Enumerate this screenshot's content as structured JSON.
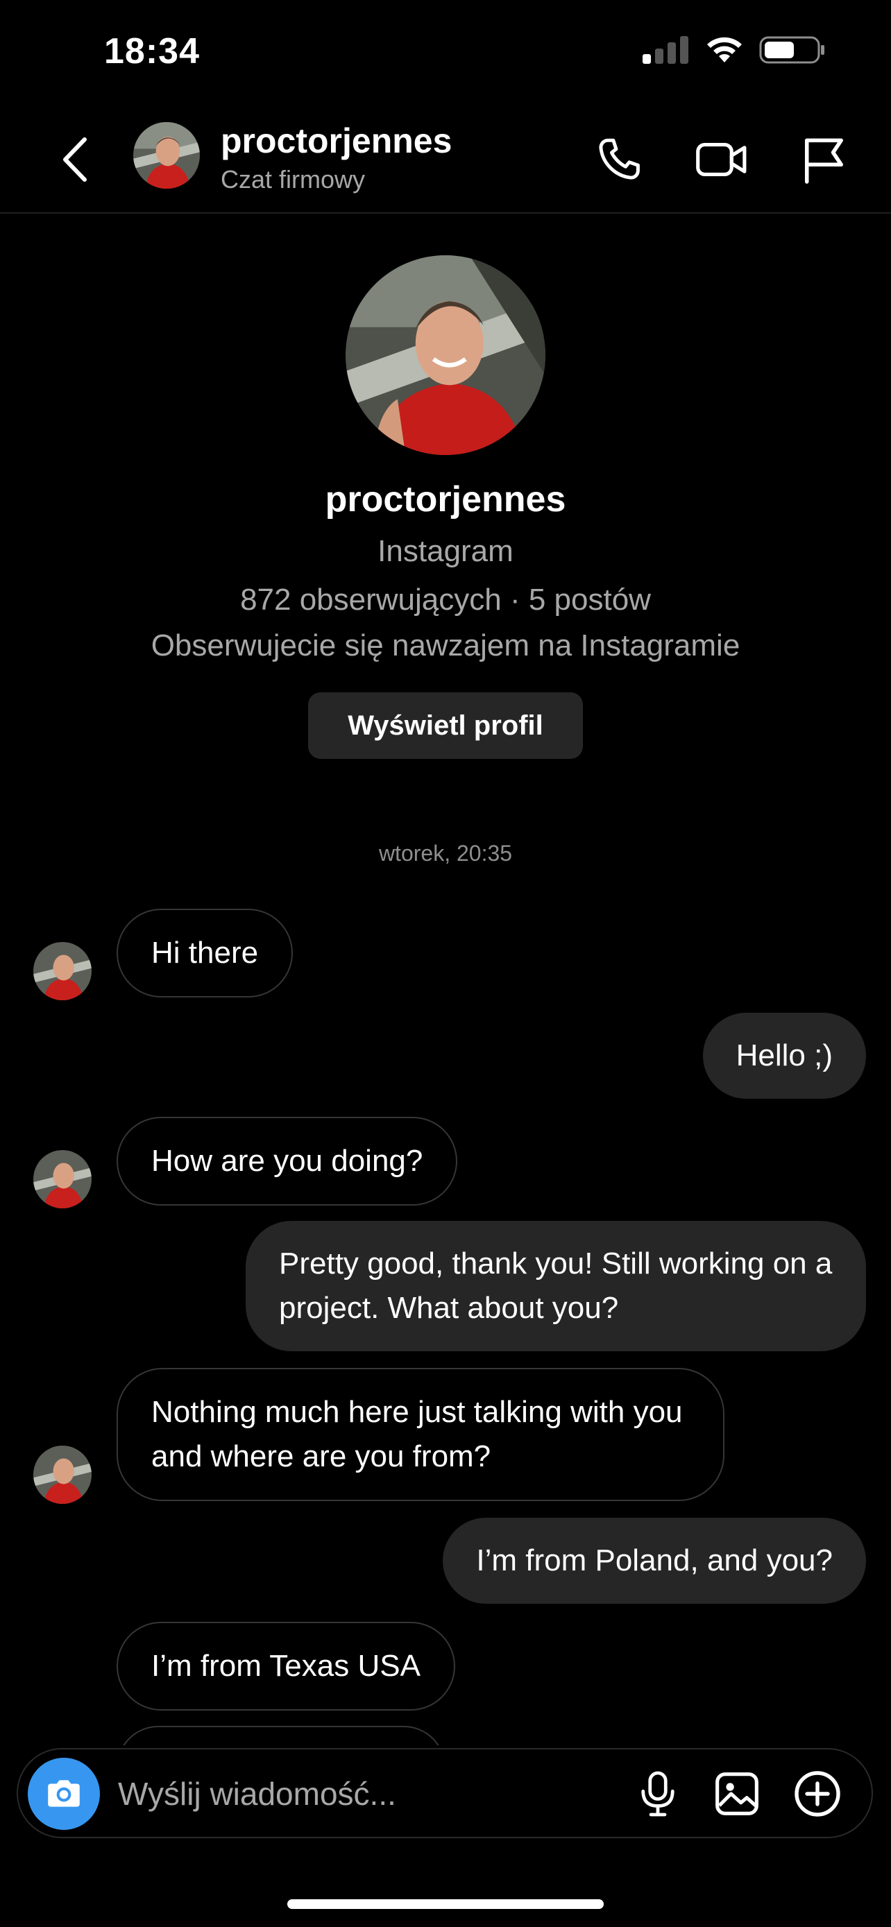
{
  "status_bar": {
    "time": "18:34"
  },
  "header": {
    "username": "proctorjennes",
    "subtitle": "Czat firmowy",
    "icons": [
      "back-icon",
      "phone-icon",
      "video-icon",
      "flag-icon"
    ]
  },
  "profile": {
    "username": "proctorjennes",
    "platform": "Instagram",
    "stats": "872 obserwujących · 5 postów",
    "mutual": "Obserwujecie się nawzajem na Instagramie",
    "view_profile_label": "Wyświetl profil"
  },
  "conversation": {
    "date_separator": "wtorek, 20:35",
    "messages": [
      {
        "from": "them",
        "text": "Hi there"
      },
      {
        "from": "me",
        "text": "Hello ;)"
      },
      {
        "from": "them",
        "text": "How are you doing?"
      },
      {
        "from": "me",
        "text": "Pretty good, thank you! Still working on a project. What about you?"
      },
      {
        "from": "them",
        "text": "Nothing much here just talking with you and where are you from?"
      },
      {
        "from": "me",
        "text": "I’m from Poland, and you?"
      },
      {
        "from": "them",
        "text": "I’m from Texas USA"
      }
    ]
  },
  "composer": {
    "placeholder": "Wyślij wiadomość...",
    "icons": [
      "camera-icon",
      "microphone-icon",
      "gallery-icon",
      "add-icon"
    ]
  },
  "colors": {
    "background": "#000000",
    "accent": "#3797f0",
    "bubble_out": "#262626",
    "secondary_text": "#a8a8a8"
  }
}
